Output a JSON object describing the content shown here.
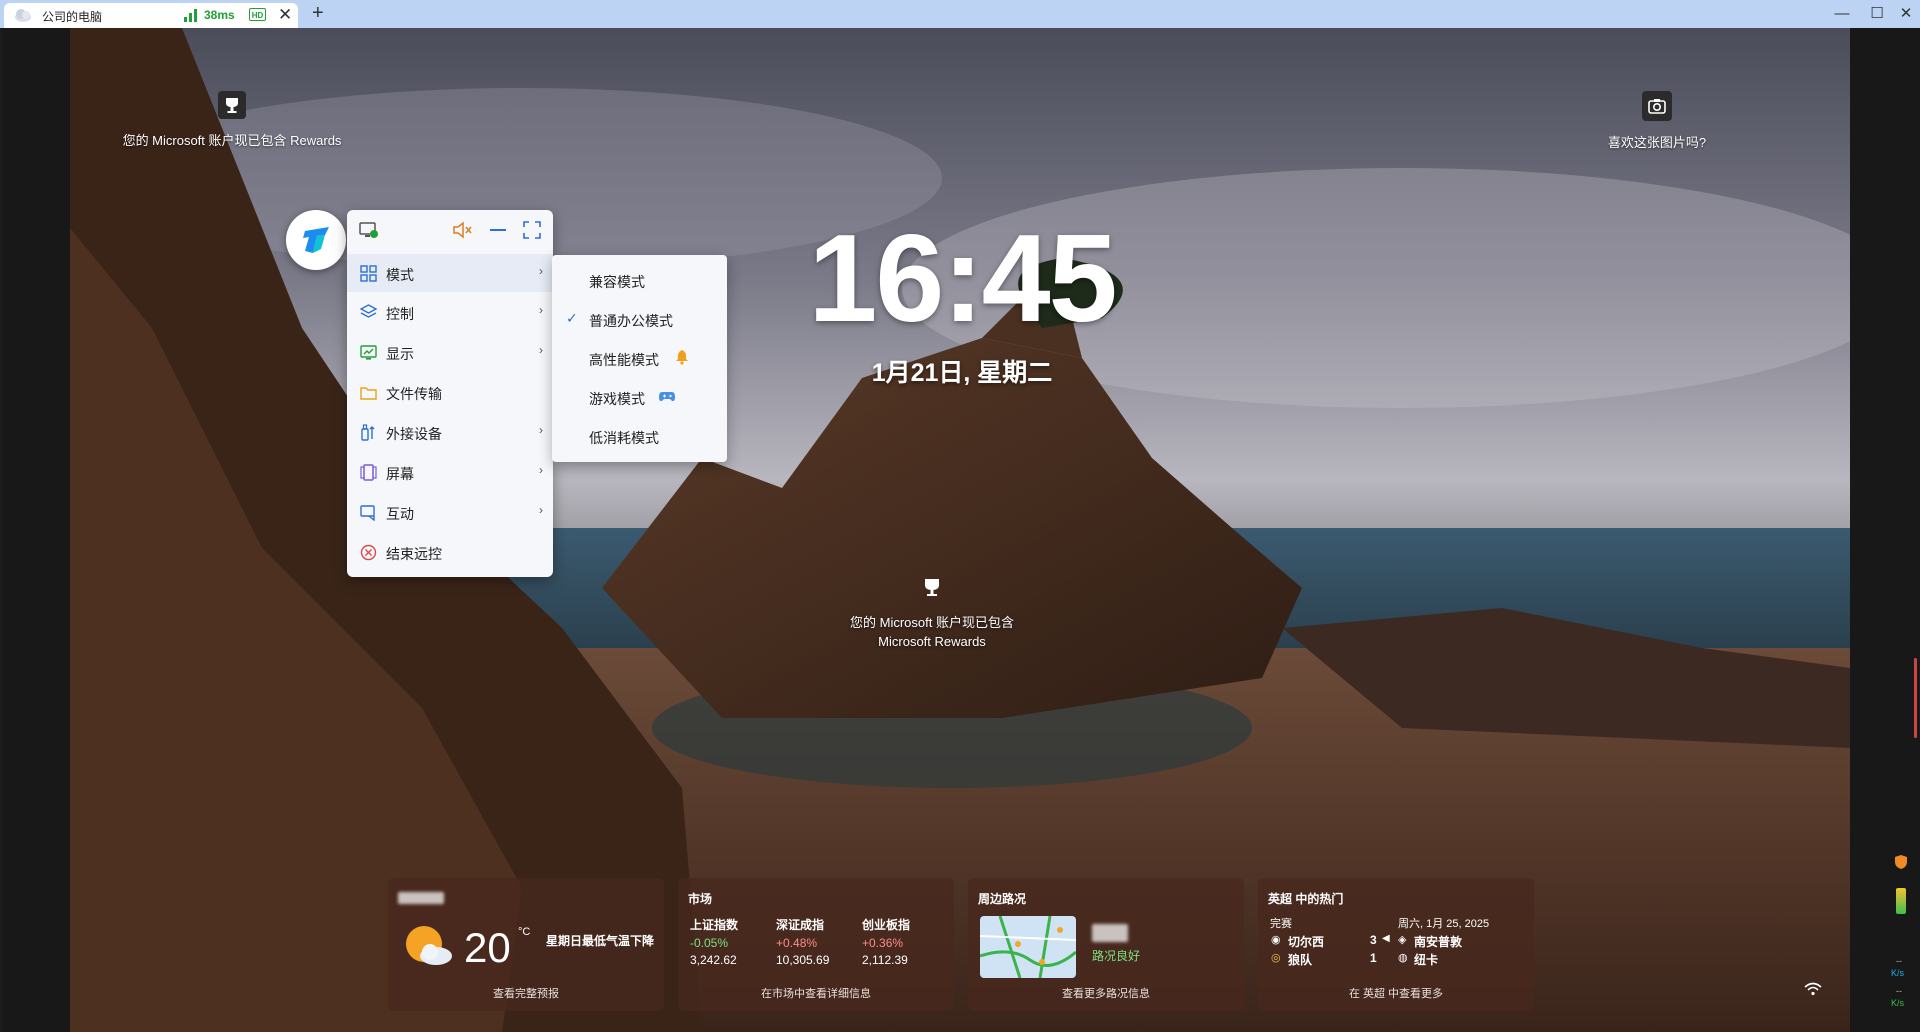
{
  "tab": {
    "title": "公司的电脑",
    "latency": "38ms",
    "hd": "HD",
    "close": "✕",
    "new_tab": "+"
  },
  "window_controls": {
    "minimize": "—",
    "maximize": "☐",
    "close": "✕"
  },
  "lockscreen": {
    "rewards_top": "您的 Microsoft 账户现已包含 Rewards",
    "like_picture": "喜欢这张图片吗?",
    "time": "16:45",
    "date": "1月21日, 星期二",
    "rewards_mid_line1": "您的 Microsoft 账户现已包含",
    "rewards_mid_line2": "Microsoft Rewards"
  },
  "menu": {
    "items": [
      {
        "label": "模式",
        "icon": "grid-icon",
        "submenu": true
      },
      {
        "label": "控制",
        "icon": "layers-icon",
        "submenu": true
      },
      {
        "label": "显示",
        "icon": "monitor-chart-icon",
        "submenu": true
      },
      {
        "label": "文件传输",
        "icon": "folder-icon",
        "submenu": false
      },
      {
        "label": "外接设备",
        "icon": "usb-icon",
        "submenu": true
      },
      {
        "label": "屏幕",
        "icon": "screens-icon",
        "submenu": true
      },
      {
        "label": "互动",
        "icon": "chat-screen-icon",
        "submenu": true
      },
      {
        "label": "结束远控",
        "icon": "close-circle-icon",
        "submenu": false
      }
    ],
    "arrow": "›"
  },
  "mode_submenu": {
    "items": [
      {
        "label": "兼容模式",
        "checked": false
      },
      {
        "label": "普通办公模式",
        "checked": true
      },
      {
        "label": "高性能模式",
        "badge": "bell-icon"
      },
      {
        "label": "游戏模式",
        "badge": "gamepad-icon"
      },
      {
        "label": "低消耗模式",
        "checked": false
      }
    ],
    "check": "✓"
  },
  "weather": {
    "temp": "20",
    "unit": "°C",
    "desc": "星期日最低气温下降",
    "footer": "查看完整预报"
  },
  "market": {
    "title": "市场",
    "stocks": [
      {
        "name": "上证指数",
        "change": "-0.05%",
        "value": "3,242.62"
      },
      {
        "name": "深证成指",
        "change": "+0.48%",
        "value": "10,305.69"
      },
      {
        "name": "创业板指",
        "change": "+0.36%",
        "value": "2,112.39"
      }
    ],
    "footer": "在市场中查看详细信息"
  },
  "traffic": {
    "title": "周边路况",
    "status": "路况良好",
    "footer": "查看更多路况信息"
  },
  "sports": {
    "title": "英超 中的热门",
    "status": "完赛",
    "date": "周六, 1月 25, 2025",
    "home_team": "切尔西",
    "home_score": "3",
    "away_team": "狼队",
    "away_score": "1",
    "winner_marker": "◀",
    "opp1": "南安普敦",
    "opp2": "纽卡",
    "footer": "在 英超 中查看更多"
  },
  "side_panel": {
    "speed_up": "K/s",
    "speed_down": "K/s",
    "dashes": "--"
  },
  "colors": {
    "accent": "#2b6fd6",
    "tab_bar": "#bcd3f3",
    "green": "#21a038"
  }
}
